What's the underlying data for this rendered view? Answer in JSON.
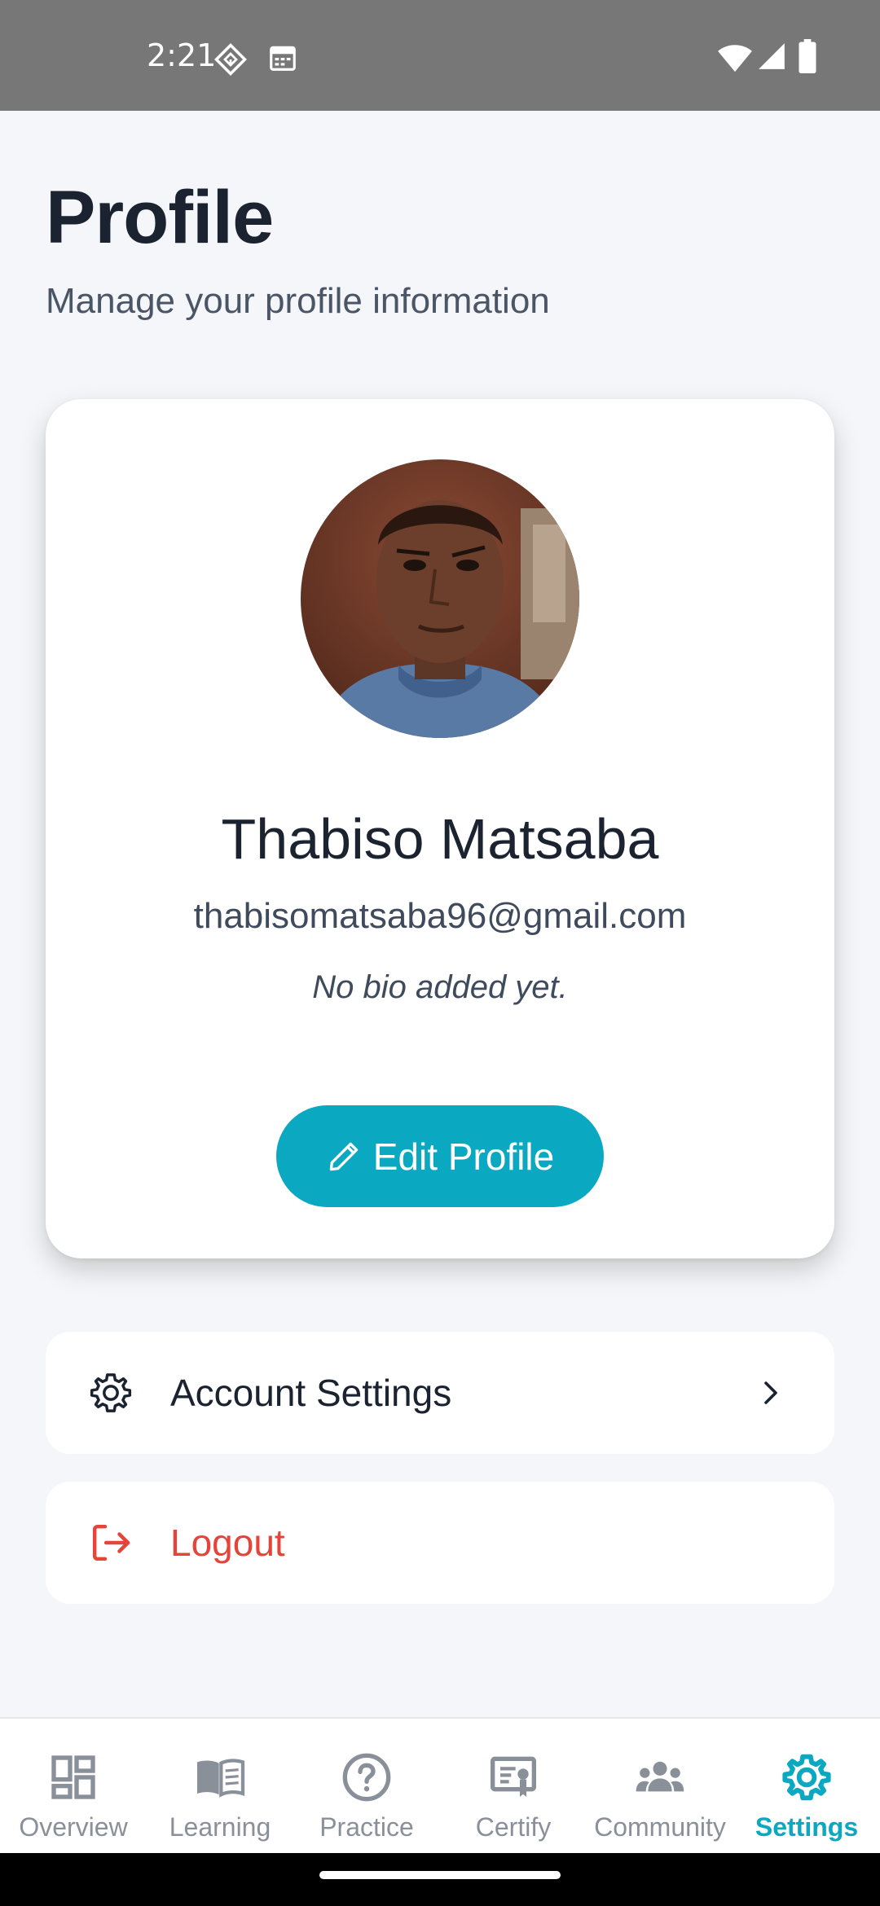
{
  "status_bar": {
    "time": "2:21",
    "icons": [
      "location-icon",
      "calendar-icon",
      "wifi-icon",
      "signal-icon",
      "battery-icon"
    ]
  },
  "page": {
    "title": "Profile",
    "subtitle": "Manage your profile information"
  },
  "profile": {
    "name": "Thabiso Matsaba",
    "email": "thabisomatsaba96@gmail.com",
    "bio": "No bio added yet.",
    "edit_button_label": "Edit Profile"
  },
  "menu": {
    "account_settings_label": "Account Settings",
    "logout_label": "Logout"
  },
  "nav": {
    "items": [
      {
        "label": "Overview",
        "icon": "overview-icon"
      },
      {
        "label": "Learning",
        "icon": "book-icon"
      },
      {
        "label": "Practice",
        "icon": "help-circle-icon"
      },
      {
        "label": "Certify",
        "icon": "certificate-icon"
      },
      {
        "label": "Community",
        "icon": "group-icon"
      },
      {
        "label": "Settings",
        "icon": "gear-icon"
      }
    ],
    "active": "Settings"
  },
  "colors": {
    "accent": "#0ba8c2",
    "danger": "#e5443a",
    "text_dark": "#1b2230",
    "inactive": "#8a9099"
  }
}
